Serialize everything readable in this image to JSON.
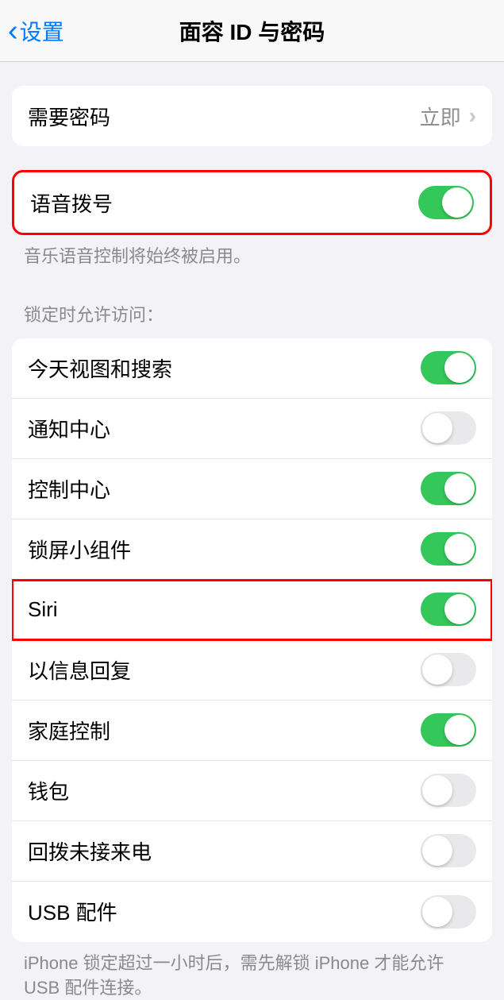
{
  "header": {
    "back_label": "设置",
    "title": "面容 ID 与密码"
  },
  "require_passcode": {
    "label": "需要密码",
    "value": "立即"
  },
  "voice_dial": {
    "label": "语音拨号",
    "on": true,
    "footer": "音乐语音控制将始终被启用。"
  },
  "lock_section": {
    "header": "锁定时允许访问：",
    "items": [
      {
        "label": "今天视图和搜索",
        "on": true
      },
      {
        "label": "通知中心",
        "on": false
      },
      {
        "label": "控制中心",
        "on": true
      },
      {
        "label": "锁屏小组件",
        "on": true
      },
      {
        "label": "Siri",
        "on": true
      },
      {
        "label": "以信息回复",
        "on": false
      },
      {
        "label": "家庭控制",
        "on": true
      },
      {
        "label": "钱包",
        "on": false
      },
      {
        "label": "回拨未接来电",
        "on": false
      },
      {
        "label": "USB 配件",
        "on": false
      }
    ],
    "footer": "iPhone 锁定超过一小时后，需先解锁 iPhone 才能允许 USB 配件连接。"
  }
}
